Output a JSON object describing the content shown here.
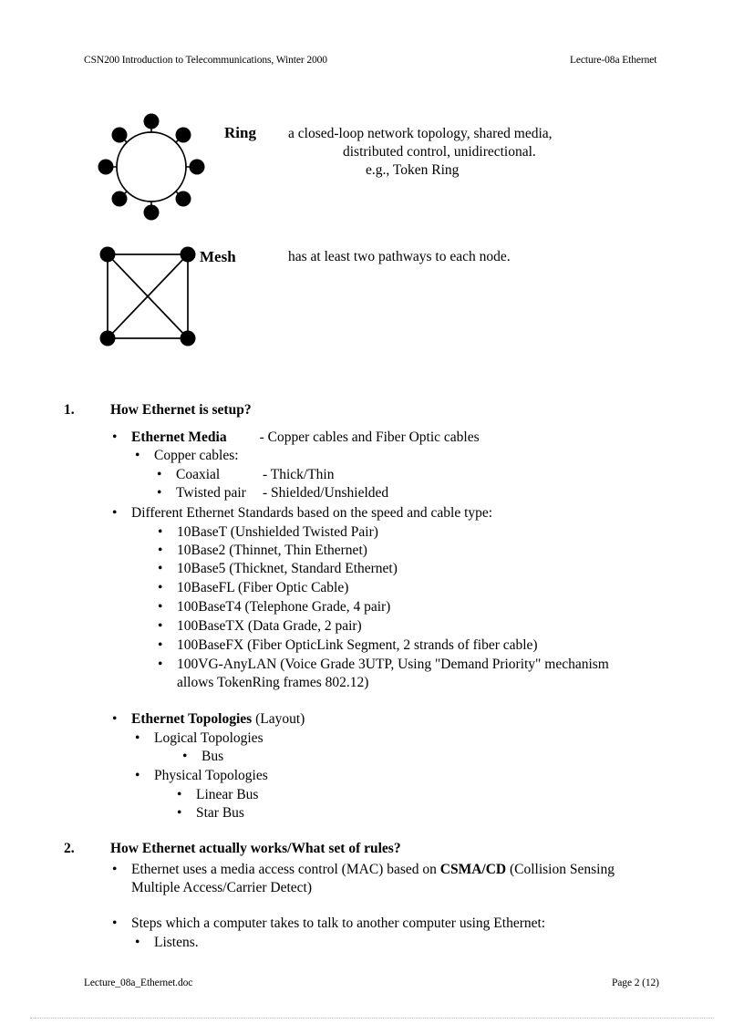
{
  "header": {
    "left": "CSN200 Introduction to Telecommunications, Winter 2000",
    "right": "Lecture-08a Ethernet"
  },
  "topologies": [
    {
      "name": "Ring",
      "diagram": "ring-topology-diagram",
      "description_lines": [
        "a closed-loop network topology, shared media,",
        "distributed  control, unidirectional.",
        "e.g., Token Ring"
      ]
    },
    {
      "name": "Mesh",
      "diagram": "mesh-topology-diagram",
      "description_lines": [
        "has at least two pathways to each node."
      ]
    }
  ],
  "sections": [
    {
      "number": "1.",
      "heading": "How Ethernet is setup?",
      "items": [
        {
          "level": 1,
          "label": "Ethernet Media",
          "bold_label": true,
          "trailing": "- Copper cables and Fiber Optic cables"
        },
        {
          "level": 2,
          "label": "Copper cables:"
        },
        {
          "level": 3,
          "label": "Coaxial",
          "trailing": "- Thick/Thin"
        },
        {
          "level": 3,
          "label": "Twisted  pair",
          "trailing": "- Shielded/Unshielded"
        },
        {
          "level": 1,
          "label": "Different  Ethernet  Standards based on the speed and cable type:"
        },
        {
          "level": 3,
          "label": "10BaseT (Unshielded  Twisted  Pair)"
        },
        {
          "level": 3,
          "label": "10Base2 (Thinnet,  Thin  Ethernet)"
        },
        {
          "level": 3,
          "label": "10Base5 (Thicknet,  Standard Ethernet)"
        },
        {
          "level": 3,
          "label": "10BaseFL (Fiber Optic Cable)"
        },
        {
          "level": 3,
          "label": "100BaseT4 (Telephone  Grade, 4 pair)"
        },
        {
          "level": 3,
          "label": "100BaseTX (Data Grade, 2 pair)"
        },
        {
          "level": 3,
          "label": "100BaseFX (Fiber OpticLink  Segment,  2 strands  of fiber  cable)"
        },
        {
          "level": 3,
          "label": "100VG-AnyLAN (Voice Grade 3UTP, Using \"Demand  Priority\"  mechanism allows  TokenRing  frames  802.12)"
        },
        {
          "level": 1,
          "label": "Ethernet Topologies",
          "bold_label": true,
          "trailing": "(Layout)"
        },
        {
          "level": 2,
          "label": "Logical  Topologies"
        },
        {
          "level": 3,
          "label": "Bus"
        },
        {
          "level": 2,
          "label": "Physical  Topologies"
        },
        {
          "level": 3,
          "label": "Linear  Bus"
        },
        {
          "level": 3,
          "label": "Star Bus"
        }
      ]
    },
    {
      "number": "2.",
      "heading": "How Ethernet actually works/What set of rules?",
      "items": [
        {
          "level": 1,
          "label": "Ethernet uses a media access control (MAC) based on ",
          "bold_mid": "CSMA/CD",
          "trailing": " (Collision  Sensing Multiple  Access/Carrier  Detect)"
        },
        {
          "level": 1,
          "label": "Steps which  a computer takes to talk to another  computer using  Ethernet:"
        },
        {
          "level": 2,
          "label": "Listens."
        }
      ]
    }
  ],
  "footer": {
    "left": "Lecture_08a_Ethernet.doc",
    "right": "Page 2 (12)"
  },
  "colors": {
    "ink": "#000000",
    "paper": "#ffffff",
    "rule": "#b8b8b8"
  }
}
